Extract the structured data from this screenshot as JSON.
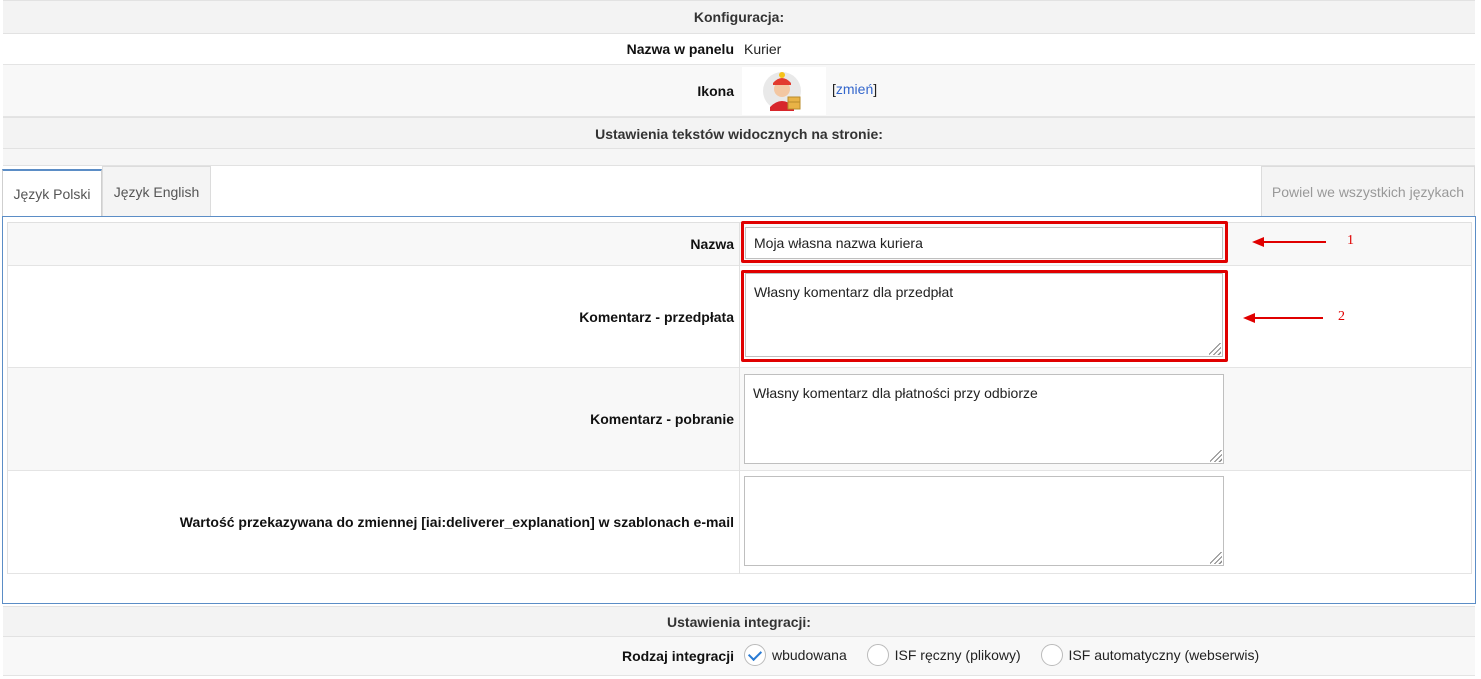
{
  "config": {
    "header": "Konfiguracja:",
    "panel_name_label": "Nazwa w panelu",
    "panel_name_value": "Kurier",
    "icon_label": "Ikona",
    "change_link": "zmień",
    "bracket_open": "[",
    "bracket_close": "]"
  },
  "texts_section": {
    "header": "Ustawienia tekstów widocznych na stronie:",
    "tabs": [
      {
        "label": "Język Polski",
        "active": true
      },
      {
        "label": "Język English",
        "active": false
      }
    ],
    "repeat_all_button": "Powiel we wszystkich językach",
    "fields": {
      "name_label": "Nazwa",
      "name_value": "Moja własna nazwa kuriera",
      "prepaid_label": "Komentarz - przedpłata",
      "prepaid_value": "Własny komentarz dla przedpłat",
      "cod_label": "Komentarz - pobranie",
      "cod_value": "Własny komentarz dla płatności przy odbiorze",
      "email_var_label": "Wartość przekazywana do zmiennej [iai:deliverer_explanation] w szablonach e-mail",
      "email_var_value": ""
    },
    "annotations": [
      "1",
      "2"
    ]
  },
  "integration": {
    "header": "Ustawienia integracji:",
    "type_label": "Rodzaj integracji",
    "options": [
      {
        "label": "wbudowana",
        "checked": true
      },
      {
        "label": "ISF ręczny (plikowy)",
        "checked": false
      },
      {
        "label": "ISF automatyczny (webserwis)",
        "checked": false
      }
    ]
  },
  "colors": {
    "accent_blue": "#5b8dc6",
    "annotation_red": "#e00000",
    "link": "#3366cc"
  }
}
